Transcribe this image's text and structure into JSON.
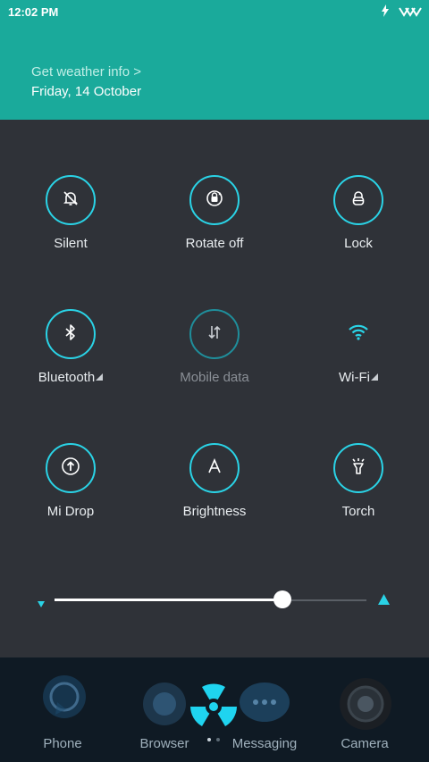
{
  "status": {
    "time": "12:02 PM"
  },
  "header": {
    "weather_link": "Get weather info >",
    "date": "Friday, 14 October"
  },
  "toggles": [
    {
      "label": "Silent",
      "icon": "bell-off-icon"
    },
    {
      "label": "Rotate off",
      "icon": "rotate-lock-icon"
    },
    {
      "label": "Lock",
      "icon": "lock-icon"
    },
    {
      "label": "Bluetooth",
      "icon": "bluetooth-icon"
    },
    {
      "label": "Mobile data",
      "icon": "mobile-data-icon"
    },
    {
      "label": "Wi-Fi",
      "icon": "wifi-icon"
    },
    {
      "label": "Mi Drop",
      "icon": "mi-drop-icon"
    },
    {
      "label": "Brightness",
      "icon": "auto-brightness-icon"
    },
    {
      "label": "Torch",
      "icon": "torch-icon"
    }
  ],
  "brightness": {
    "level": 0.73
  },
  "dock": {
    "apps": [
      {
        "label": "Phone",
        "icon": "phone-app-icon"
      },
      {
        "label": "Browser",
        "icon": "browser-app-icon"
      },
      {
        "label": "Messaging",
        "icon": "messaging-app-icon"
      },
      {
        "label": "Camera",
        "icon": "camera-app-icon"
      }
    ],
    "page_indicator": {
      "current": 1,
      "total": 2
    }
  },
  "colors": {
    "accent": "#2ad3e6",
    "header": "#1aaa9b",
    "panel": "#2f3238"
  }
}
